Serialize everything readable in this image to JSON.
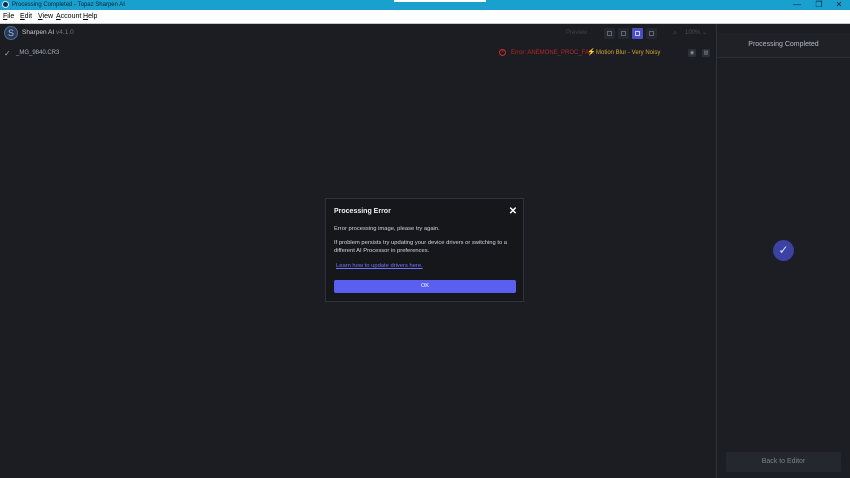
{
  "window": {
    "title": "Processing Completed - Topaz Sharpen AI",
    "controls": {
      "minimize": "—",
      "restore": "❐",
      "close": "✕"
    }
  },
  "menu": [
    "File",
    "Edit",
    "View",
    "Account",
    "Help"
  ],
  "app": {
    "name": "Sharpen AI",
    "version": "v4.1.0",
    "logo_letter": "S"
  },
  "toolbar": {
    "preview_label": "Preview",
    "zoom_value": "100%",
    "zoom_icon": "magnifier-icon",
    "active_view": "grid"
  },
  "file": {
    "name": "_MG_9840.CR3",
    "error": "Error: ANEMONE_PROC_FAIL",
    "model": "Motion Blur - Very Noisy"
  },
  "sidebar": {
    "status": "Processing Completed",
    "back_button": "Back to Editor"
  },
  "dialog": {
    "title": "Processing Error",
    "line1": "Error processing image, please try again.",
    "line2": "If problem persists try updating your device drivers or switching to a different AI Processor in preferences.",
    "link": "Learn how to update drivers here.",
    "ok": "OK"
  },
  "colors": {
    "accent": "#5b5ff0",
    "titlebar": "#1aa0cf",
    "error": "#b52626",
    "warning": "#d4a52a"
  }
}
